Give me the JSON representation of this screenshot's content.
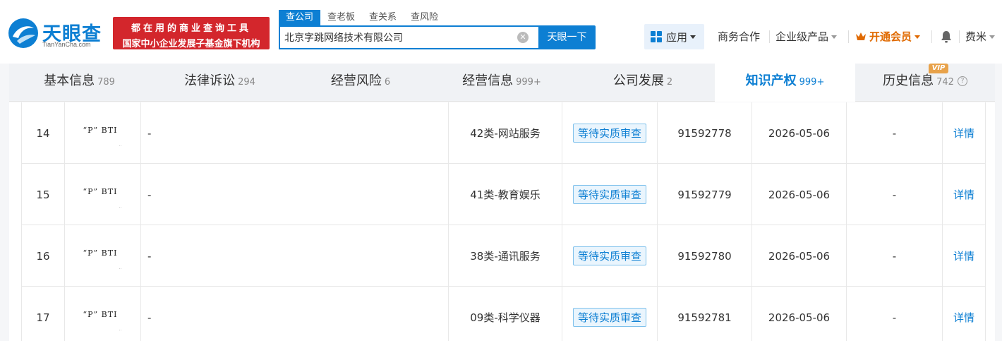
{
  "header": {
    "logo_text": "天眼查",
    "logo_sub": "TianYanCha.com",
    "slogan_line1": "都在用的商业查询工具",
    "slogan_line2": "国家中小企业发展子基金旗下机构",
    "search_tabs": [
      "查公司",
      "查老板",
      "查关系",
      "查风险"
    ],
    "search_value": "北京字跳网络技术有限公司",
    "search_button": "天眼一下",
    "apps_label": "应用",
    "business_label": "商务合作",
    "enterprise_label": "企业级产品",
    "vip_label": "开通会员",
    "user_name": "费米"
  },
  "tabs": [
    {
      "label": "基本信息",
      "count": "789"
    },
    {
      "label": "法律诉讼",
      "count": "294"
    },
    {
      "label": "经营风险",
      "count": "6"
    },
    {
      "label": "经营信息",
      "count": "999+"
    },
    {
      "label": "公司发展",
      "count": "2"
    },
    {
      "label": "知识产权",
      "count": "999+"
    },
    {
      "label": "历史信息",
      "count": "742"
    }
  ],
  "vip_badge": "VIP",
  "rows": [
    {
      "index": "14",
      "mark": "“P” BTI",
      "name": "-",
      "category": "42类-网站服务",
      "status": "等待实质审查",
      "reg_no": "91592778",
      "date": "2026-05-06",
      "extra": "-",
      "action": "详情"
    },
    {
      "index": "15",
      "mark": "“P” BTI",
      "name": "-",
      "category": "41类-教育娱乐",
      "status": "等待实质审查",
      "reg_no": "91592779",
      "date": "2026-05-06",
      "extra": "-",
      "action": "详情"
    },
    {
      "index": "16",
      "mark": "“P” BTI",
      "name": "-",
      "category": "38类-通讯服务",
      "status": "等待实质审查",
      "reg_no": "91592780",
      "date": "2026-05-06",
      "extra": "-",
      "action": "详情"
    },
    {
      "index": "17",
      "mark": "“P” BTI",
      "name": "-",
      "category": "09类-科学仪器",
      "status": "等待实质审查",
      "reg_no": "91592781",
      "date": "2026-05-06",
      "extra": "-",
      "action": "详情"
    }
  ],
  "colors": {
    "brand": "#0d7fd3",
    "slogan_bg": "#d3262c",
    "vip": "#e06a00"
  }
}
